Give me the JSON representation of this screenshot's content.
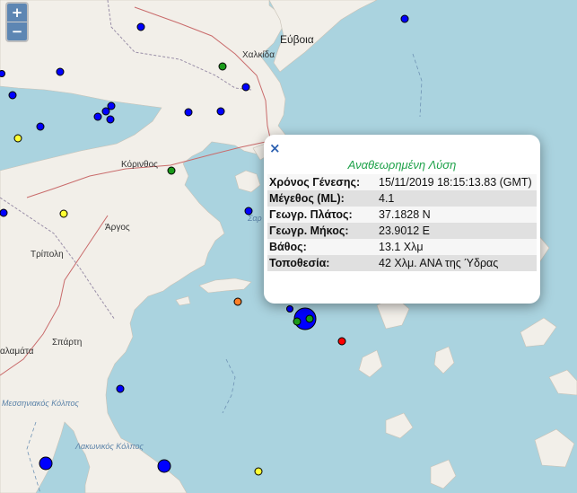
{
  "controls": {
    "zoom_in": "+",
    "zoom_out": "−"
  },
  "labels": {
    "evia": "Εύβοια",
    "chalkida": "Χαλκίδα",
    "korinthos": "Κόρινθος",
    "argos": "Άργος",
    "tripoli": "Τρίπολη",
    "sparti": "Σπάρτη",
    "kalamata": "αλαμάτα",
    "messiniakos": "Μεσσηνιακός Κόλπος",
    "lakonikos": "Λακωνικός Κόλπος",
    "saronikos": "Σαρ"
  },
  "popup": {
    "close": "×",
    "title": "Αναθεωρημένη Λύση",
    "rows": [
      {
        "key": "Χρόνος Γένεσης:",
        "value": "15/11/2019 18:15:13.83 (GMT)"
      },
      {
        "key": "Μέγεθος (ML):",
        "value": "4.1"
      },
      {
        "key": "Γεωγρ. Πλάτος:",
        "value": "37.1828 N"
      },
      {
        "key": "Γεωγρ. Μήκος:",
        "value": "23.9012 E"
      },
      {
        "key": "Βάθος:",
        "value": "13.1 Χλμ"
      },
      {
        "key": "Τοποθεσία:",
        "value": "42 Χλμ. ΑΝΑ της Ύδρας"
      }
    ]
  },
  "colors": {
    "sea": "#aad3df",
    "land": "#f2efe9",
    "marker_blue": "#0000ff",
    "marker_green": "#1a9a1a",
    "marker_yellow": "#ffff33",
    "marker_orange": "#ff7f27",
    "marker_red": "#ff0000",
    "popup_title": "#1fa24a"
  }
}
